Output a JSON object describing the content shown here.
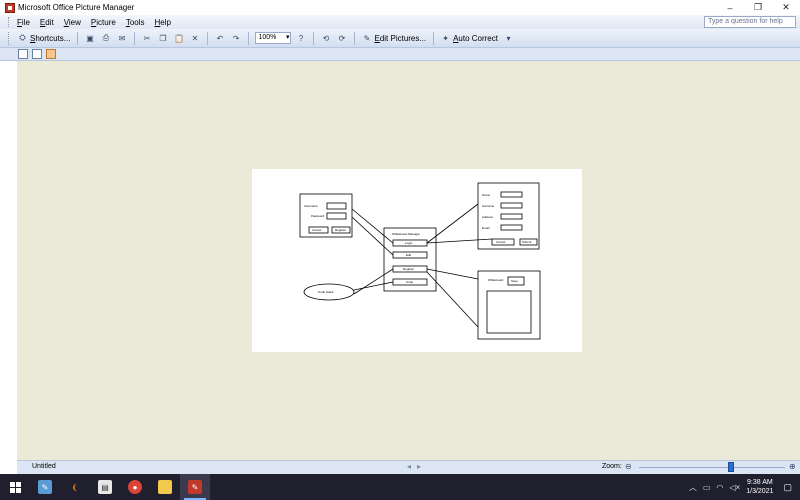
{
  "window": {
    "title": "Microsoft Office Picture Manager",
    "controls": [
      "–",
      "❐",
      "✕"
    ]
  },
  "menu": {
    "items": [
      "File",
      "Edit",
      "View",
      "Picture",
      "Tools",
      "Help"
    ],
    "help_placeholder": "Type a question for help"
  },
  "toolbar": {
    "shortcuts_label": "Shortcuts...",
    "zoom_value": "100%",
    "edit_pictures_label": "Edit Pictures...",
    "auto_correct_label": "Auto Correct"
  },
  "status": {
    "filename": "Untitled",
    "zoom_label": "Zoom:",
    "zoom_fraction": 0.63
  },
  "diagram": {
    "login_box": {
      "field_1": "Username",
      "field_2": "Password",
      "btn_1": "Cancel",
      "btn_2": "Register"
    },
    "center_box": {
      "title": "Whiteboard Manager",
      "items": [
        "Login",
        "Edit",
        "Register",
        "Undo"
      ]
    },
    "right_top_box": {
      "fields": [
        "Name",
        "Surname",
        "Address",
        "Email"
      ],
      "btn_1": "Cancel",
      "btn_2": "Submit"
    },
    "right_bottom_box": {
      "label": "Whiteboard",
      "button": "Save"
    },
    "ellipse_label": "Undo Stack"
  },
  "taskbar": {
    "time": "9:38 AM",
    "date": "1/3/2021"
  }
}
